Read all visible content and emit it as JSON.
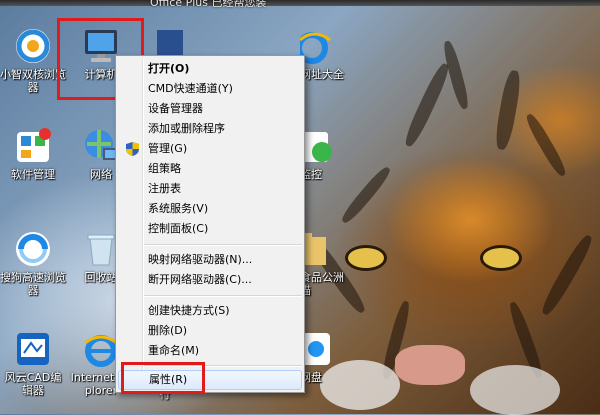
{
  "top_label": "Office Plus 已经帮您装",
  "desktop_icons": [
    {
      "label": "小智双核浏览器",
      "icon": "xiaozhi-browser-icon"
    },
    {
      "label": "计算机",
      "icon": "computer-icon"
    },
    {
      "label": "软件管理",
      "icon": "software-manager-icon"
    },
    {
      "label": "网络",
      "icon": "network-icon"
    },
    {
      "label": "搜狗高速浏览器",
      "icon": "sogou-browser-icon"
    },
    {
      "label": "回收站",
      "icon": "recycle-bin-icon"
    },
    {
      "label": "风云CAD编辑器",
      "icon": "fengyun-cad-icon"
    },
    {
      "label": "Internet Explorer",
      "icon": "ie-icon"
    },
    {
      "label": "网址大全",
      "icon": "ie-sites-icon"
    },
    {
      "label": "监控",
      "icon": "monitor-icon"
    },
    {
      "label": "食品公洲猫",
      "icon": "folder-icon"
    },
    {
      "label": "网盘",
      "icon": "netdisk-icon"
    },
    {
      "label": "行",
      "icon": "partial-icon"
    }
  ],
  "context_menu": [
    {
      "label": "打开(O)",
      "bold": true
    },
    {
      "label": "CMD快速通道(Y)"
    },
    {
      "label": "设备管理器"
    },
    {
      "label": "添加或删除程序"
    },
    {
      "label": "管理(G)",
      "icon": "uac-shield-icon"
    },
    {
      "label": "组策略"
    },
    {
      "label": "注册表"
    },
    {
      "label": "系统服务(V)"
    },
    {
      "label": "控制面板(C)"
    },
    {
      "separator": true
    },
    {
      "label": "映射网络驱动器(N)..."
    },
    {
      "label": "断开网络驱动器(C)..."
    },
    {
      "separator": true
    },
    {
      "label": "创建快捷方式(S)"
    },
    {
      "label": "删除(D)"
    },
    {
      "label": "重命名(M)"
    },
    {
      "separator": true
    },
    {
      "label": "属性(R)",
      "hover": true
    }
  ],
  "colors": {
    "highlight": "#e11a1a",
    "menu_bg": "#f1f1f1"
  }
}
